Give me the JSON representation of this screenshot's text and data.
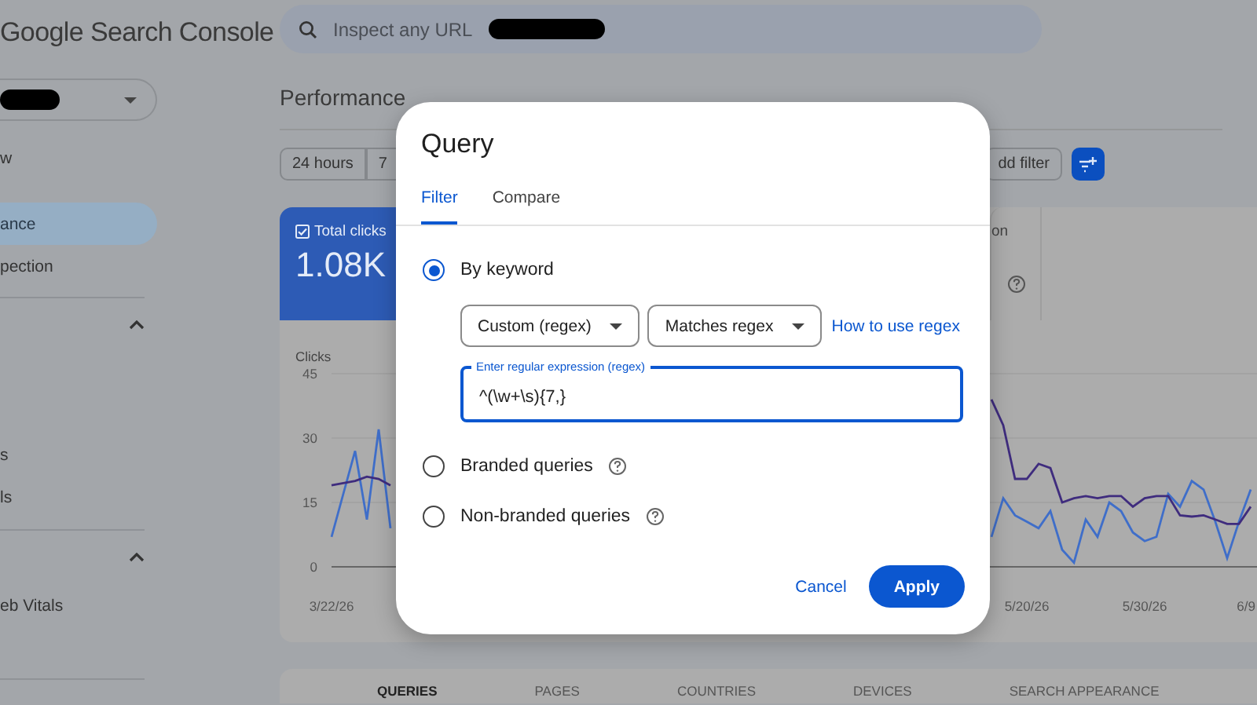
{
  "app": {
    "title": "Google Search Console"
  },
  "search": {
    "placeholder": "Inspect any URL"
  },
  "sidebar": {
    "items": [
      {
        "label": "w",
        "selected": false
      },
      {
        "label": "ance",
        "selected": true
      },
      {
        "label": "pection",
        "selected": false
      }
    ],
    "sections": [
      {
        "expanded": true,
        "items": [
          {
            "label": "s",
            "selected": false
          },
          {
            "label": "ls",
            "selected": false
          }
        ]
      },
      {
        "expanded": true,
        "items": [
          {
            "label": "eb Vitals",
            "selected": false
          }
        ]
      }
    ]
  },
  "page": {
    "title": "Performance"
  },
  "date_chips": [
    {
      "label": "24 hours",
      "selected": false
    },
    {
      "label": "7",
      "selected": false
    }
  ],
  "add_filter": {
    "label": "dd filter"
  },
  "metrics": [
    {
      "label": "Total clicks",
      "value": "1.08K",
      "selected": true,
      "help": false
    },
    {
      "label": "on",
      "selected": false,
      "help": true
    }
  ],
  "chart": {
    "chart_data": {
      "type": "line",
      "ylabel": "Clicks",
      "categories": [
        "3/22/26",
        null,
        null,
        null,
        null,
        null,
        null,
        null,
        null,
        null,
        null,
        null,
        null,
        null,
        null,
        null,
        null,
        null,
        null,
        null,
        null,
        null,
        null,
        null,
        null,
        null,
        null,
        null,
        null,
        null,
        null,
        null,
        null,
        null,
        null,
        null,
        null,
        null,
        null,
        null,
        null,
        null,
        null,
        null,
        null,
        null,
        null,
        null,
        null,
        null,
        null,
        null,
        null,
        null,
        null,
        null,
        null,
        null,
        null,
        "5/20/26",
        null,
        null,
        null,
        null,
        null,
        null,
        null,
        null,
        null,
        "5/30/26",
        null,
        null,
        null,
        null,
        null,
        null,
        null,
        null,
        "6/9"
      ],
      "ylim": [
        0,
        45
      ],
      "yticks": [
        0,
        15,
        30,
        45
      ],
      "series": [
        {
          "color": "#3f6ec9",
          "values": [
            7,
            17,
            27,
            11,
            32,
            9,
            null,
            null,
            null,
            null,
            null,
            null,
            null,
            null,
            null,
            null,
            null,
            null,
            null,
            null,
            null,
            null,
            null,
            null,
            null,
            null,
            null,
            null,
            null,
            null,
            null,
            null,
            null,
            null,
            null,
            null,
            null,
            null,
            null,
            null,
            null,
            null,
            null,
            null,
            null,
            null,
            null,
            null,
            null,
            null,
            null,
            null,
            null,
            null,
            null,
            null,
            7,
            16,
            12,
            10.5,
            9,
            13,
            4,
            1,
            11,
            7,
            15,
            13,
            8,
            6,
            7,
            17,
            14,
            20,
            18,
            10.5,
            2,
            10.5,
            18
          ]
        },
        {
          "color": "#3f2c7e",
          "values": [
            19,
            19.5,
            20,
            21,
            20.5,
            19,
            null,
            null,
            null,
            null,
            null,
            null,
            null,
            null,
            null,
            null,
            null,
            null,
            null,
            null,
            null,
            null,
            null,
            null,
            null,
            null,
            null,
            null,
            null,
            null,
            null,
            null,
            null,
            null,
            null,
            null,
            null,
            null,
            null,
            null,
            null,
            null,
            null,
            null,
            null,
            null,
            null,
            null,
            null,
            null,
            null,
            null,
            null,
            null,
            null,
            null,
            39,
            33,
            20.5,
            20.5,
            24,
            23,
            15,
            16,
            16.5,
            16,
            16.5,
            16.5,
            14,
            16,
            16.5,
            16.5,
            12,
            11.7,
            12,
            11,
            10,
            10,
            14
          ]
        }
      ]
    }
  },
  "bottom_tabs": [
    {
      "label": "QUERIES",
      "selected": true
    },
    {
      "label": "PAGES",
      "selected": false
    },
    {
      "label": "COUNTRIES",
      "selected": false
    },
    {
      "label": "DEVICES",
      "selected": false
    },
    {
      "label": "SEARCH APPEARANCE",
      "selected": false
    }
  ],
  "dialog": {
    "title": "Query",
    "tabs": [
      {
        "label": "Filter",
        "selected": true
      },
      {
        "label": "Compare",
        "selected": false
      }
    ],
    "options": [
      {
        "label": "By keyword",
        "selected": true,
        "help": false,
        "dropdowns": [
          "Custom (regex)",
          "Matches regex"
        ],
        "link": "How to use regex",
        "field": {
          "label": "Enter regular expression (regex)",
          "value": "^(\\w+\\s){7,}"
        }
      },
      {
        "label": "Branded queries",
        "selected": false,
        "help": true
      },
      {
        "label": "Non-branded queries",
        "selected": false,
        "help": true
      }
    ],
    "buttons": [
      {
        "label": "Cancel",
        "kind": "text"
      },
      {
        "label": "Apply",
        "kind": "filled"
      }
    ]
  }
}
